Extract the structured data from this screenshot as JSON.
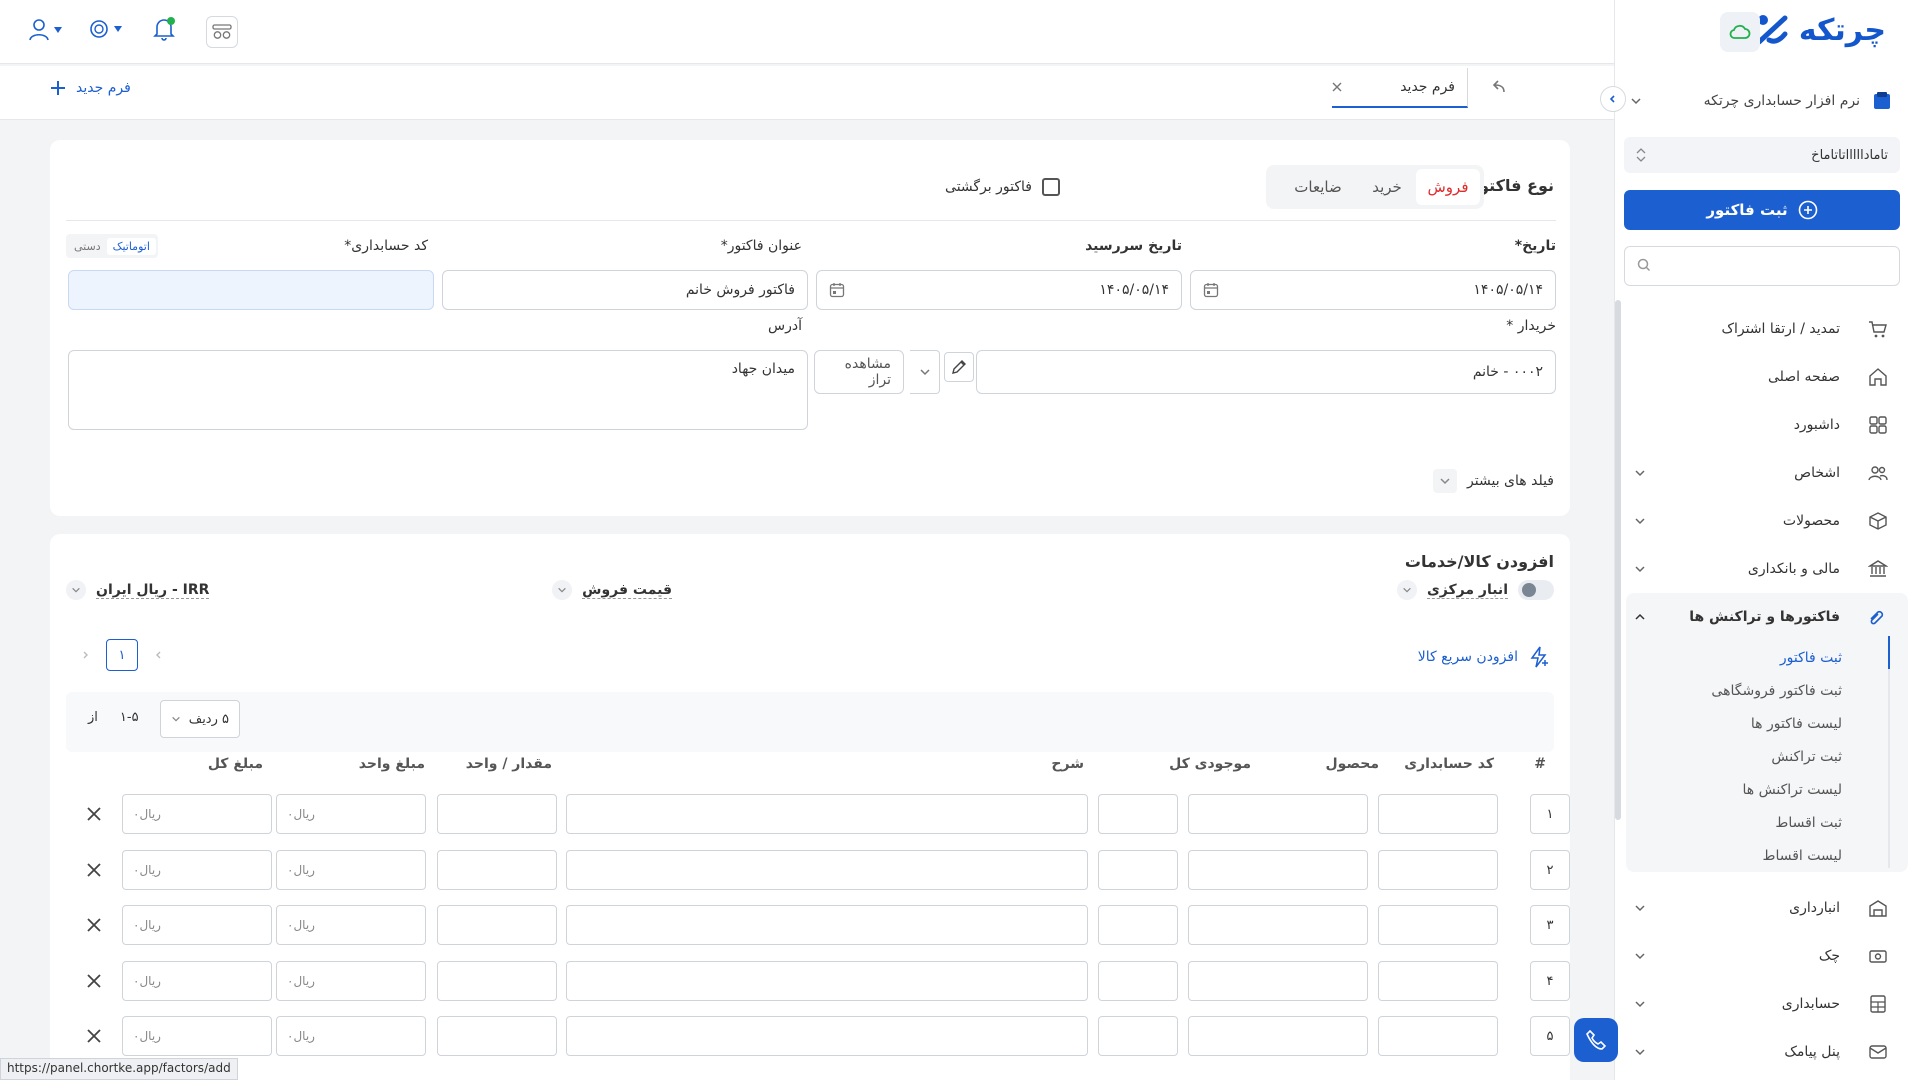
{
  "brand": {
    "name": "چرتکه"
  },
  "sidebar": {
    "company_name": "نرم افزار حسابداری چرتکه",
    "fiscal_year": "تاماداااااتاتاماخ",
    "primary_action": "ثبت فاکتور",
    "search_placeholder": "",
    "items": [
      {
        "label": "تمدید / ارتقا اشتراک",
        "icon": "cart-icon"
      },
      {
        "label": "صفحه اصلی",
        "icon": "home-icon"
      },
      {
        "label": "داشبورد",
        "icon": "dashboard-icon"
      },
      {
        "label": "اشخاص",
        "icon": "people-icon"
      },
      {
        "label": "محصولات",
        "icon": "box-icon"
      },
      {
        "label": "مالی و بانکداری",
        "icon": "bank-icon"
      },
      {
        "label": "فاکتورها و تراکنش ها",
        "icon": "invoice-icon"
      },
      {
        "label": "انبارداری",
        "icon": "warehouse-icon"
      },
      {
        "label": "چک",
        "icon": "cheque-icon"
      },
      {
        "label": "حسابداری",
        "icon": "calculator-icon"
      },
      {
        "label": "پنل پیامک",
        "icon": "sms-icon"
      }
    ],
    "sub_items": [
      "ثبت فاکتور",
      "ثبت فاکتور فروشگاهی",
      "لیست فاکتور ها",
      "ثبت تراکنش",
      "لیست تراکنش ها",
      "ثبت اقساط",
      "لیست اقساط"
    ]
  },
  "tabs": {
    "active_tab": "فرم جدید",
    "new_form": "فرم جدید"
  },
  "form": {
    "invoice_type_label": "نوع فاکتور",
    "type_options": [
      "فروش",
      "خرید",
      "ضایعات"
    ],
    "return_invoice_label": "فاکتور برگشتی",
    "date_label": "تاریخ*",
    "date_value": "۱۴۰۵/۰۵/۱۴",
    "due_date_label": "تاریخ سررسید",
    "due_date_value": "۱۴۰۵/۰۵/۱۴",
    "title_label": "عنوان فاکتور*",
    "title_value": "فاکتور فروش خانم",
    "account_code_label": "کد حسابداری*",
    "code_mode_auto": "اتوماتیک",
    "code_mode_manual": "دستی",
    "buyer_label": "خریدار *",
    "buyer_value": "۰۰۰۲ - خانم",
    "view_balance": "مشاهده تراز",
    "address_label": "آدرس",
    "address_value": "میدان جهاد",
    "more_fields": "فیلد های بیشتر"
  },
  "items_section": {
    "title": "افزودن کالا/خدمات",
    "warehouse": "انبار مرکزی",
    "price_type": "قیمت فروش",
    "currency": "IRR - ریال ایران",
    "quick_add": "افزودن سریع کالا",
    "page": "۱",
    "rows_per_page": "۵ ردیف",
    "range": "۱-۵",
    "of": "از",
    "headers": [
      "#",
      "کد حسابداری",
      "محصول",
      "موجودی کل",
      "شرح",
      "مقدار / واحد",
      "مبلغ واحد",
      "مبلغ کل"
    ],
    "rows": [
      {
        "no": "۱",
        "unit_price": "ریال۰",
        "total": "ریال۰"
      },
      {
        "no": "۲",
        "unit_price": "ریال۰",
        "total": "ریال۰"
      },
      {
        "no": "۳",
        "unit_price": "ریال۰",
        "total": "ریال۰"
      },
      {
        "no": "۴",
        "unit_price": "ریال۰",
        "total": "ریال۰"
      },
      {
        "no": "۵",
        "unit_price": "ریال۰",
        "total": "ریال۰"
      }
    ]
  },
  "status_url": "https://panel.chortke.app/factors/add",
  "colors": {
    "primary": "#1b5fd1",
    "danger": "#e02b2b",
    "notify": "#22b14c"
  }
}
